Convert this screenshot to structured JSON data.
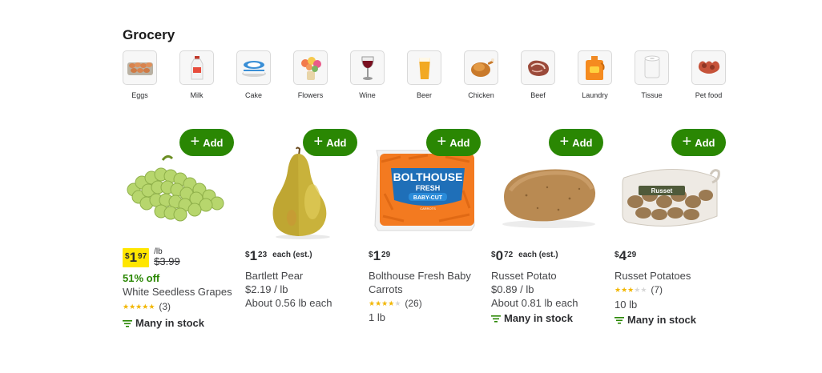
{
  "section": {
    "title": "Grocery"
  },
  "categories": [
    {
      "label": "Eggs",
      "icon": "eggs-icon"
    },
    {
      "label": "Milk",
      "icon": "milk-icon"
    },
    {
      "label": "Cake",
      "icon": "cake-icon"
    },
    {
      "label": "Flowers",
      "icon": "flowers-icon"
    },
    {
      "label": "Wine",
      "icon": "wine-icon"
    },
    {
      "label": "Beer",
      "icon": "beer-icon"
    },
    {
      "label": "Chicken",
      "icon": "chicken-icon"
    },
    {
      "label": "Beef",
      "icon": "beef-icon"
    },
    {
      "label": "Laundry",
      "icon": "laundry-icon"
    },
    {
      "label": "Tissue",
      "icon": "tissue-icon"
    },
    {
      "label": "Pet food",
      "icon": "pet-food-icon"
    }
  ],
  "colors": {
    "add_button": "#2a8703",
    "rollback_badge": "#ffe600",
    "deal_text": "#2a8703",
    "star": "#f2b705"
  },
  "products": [
    {
      "add_label": "Add",
      "price_currency": "$",
      "price_dollars": "1",
      "price_cents": "97",
      "unit": "/lb",
      "was_price": "$3.99",
      "deal": "51% off",
      "name": "White Seedless Grapes",
      "stars": 5,
      "reviews": "(3)",
      "stock": "Many in stock",
      "image": "grapes"
    },
    {
      "add_label": "Add",
      "price_currency": "$",
      "price_dollars": "1",
      "price_cents": "23",
      "each_label": "each (est.)",
      "name": "Bartlett Pear",
      "unit_price": "$2.19 / lb",
      "approx": "About 0.56 lb each",
      "image": "pear"
    },
    {
      "add_label": "Add",
      "price_currency": "$",
      "price_dollars": "1",
      "price_cents": "29",
      "name": "Bolthouse Fresh Baby Carrots",
      "stars": 4,
      "reviews": "(26)",
      "size": "1 lb",
      "image": "carrots",
      "package_text": [
        "BOLTHOUSE",
        "FRESH",
        "BABY-CUT",
        "CARROTS"
      ]
    },
    {
      "add_label": "Add",
      "price_currency": "$",
      "price_dollars": "0",
      "price_cents": "72",
      "each_label": "each (est.)",
      "name": "Russet Potato",
      "unit_price": "$0.89 / lb",
      "approx": "About 0.81 lb each",
      "stock": "Many in stock",
      "image": "potato"
    },
    {
      "add_label": "Add",
      "price_currency": "$",
      "price_dollars": "4",
      "price_cents": "29",
      "name": "Russet Potatoes",
      "stars": 3,
      "reviews": "(7)",
      "size": "10 lb",
      "stock": "Many in stock",
      "image": "potato-bag",
      "package_text": [
        "Russet"
      ]
    }
  ]
}
